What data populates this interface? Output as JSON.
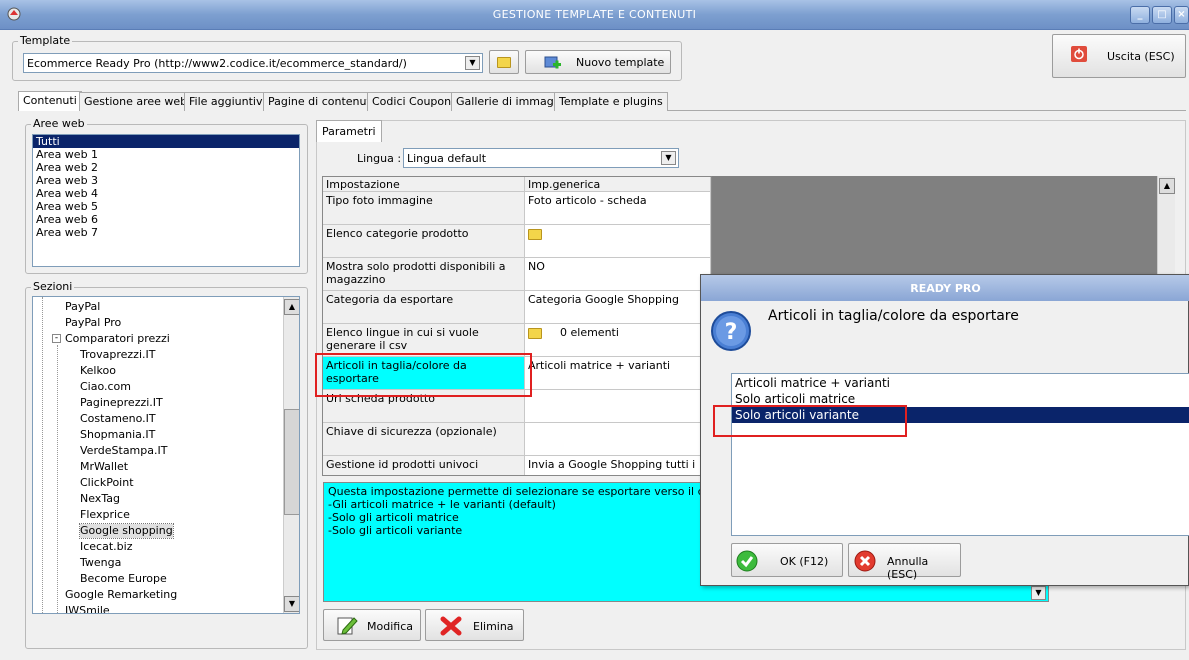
{
  "window": {
    "title": "GESTIONE TEMPLATE E CONTENUTI"
  },
  "template": {
    "group_label": "Template",
    "selected": "Ecommerce Ready Pro (http://www2.codice.it/ecommerce_standard/)",
    "new_button": "Nuovo template"
  },
  "exit_button": "Uscita (ESC)",
  "tabs": [
    "Contenuti",
    "Gestione aree web",
    "File aggiuntivi",
    "Pagine di contenuti",
    "Codici Coupon",
    "Gallerie di immagini",
    "Template e plugins"
  ],
  "aree_web": {
    "label": "Aree web",
    "items": [
      "Tutti",
      "Area web 1",
      "Area web 2",
      "Area web 3",
      "Area web 4",
      "Area web 5",
      "Area web 6",
      "Area web 7"
    ]
  },
  "sezioni": {
    "label": "Sezioni",
    "items": [
      "PayPal",
      "PayPal Pro",
      "Comparatori prezzi",
      "Trovaprezzi.IT",
      "Kelkoo",
      "Ciao.com",
      "Pagineprezzi.IT",
      "Costameno.IT",
      "Shopmania.IT",
      "VerdeStampa.IT",
      "MrWallet",
      "ClickPoint",
      "NexTag",
      "Flexprice",
      "Google shopping",
      "Icecat.biz",
      "Twenga",
      "Become Europe",
      "Google Remarketing",
      "IWSmile"
    ]
  },
  "parametri": {
    "tab": "Parametri",
    "lingua_label": "Lingua :",
    "lingua_value": "Lingua default",
    "headers": [
      "Impostazione",
      "Imp.generica"
    ],
    "rows": [
      {
        "name": "Tipo foto immagine",
        "value": "Foto articolo - scheda"
      },
      {
        "name": "Elenco categorie prodotto",
        "value": ""
      },
      {
        "name": "Mostra solo prodotti disponibili a magazzino",
        "value": "NO"
      },
      {
        "name": "Categoria da esportare",
        "value": "Categoria Google Shopping"
      },
      {
        "name": "Elenco lingue in cui si vuole generare il csv",
        "value": "0 elementi"
      },
      {
        "name": "Articoli in taglia/colore da esportare",
        "value": "Articoli matrice + varianti"
      },
      {
        "name": "Url scheda prodotto",
        "value": ""
      },
      {
        "name": "Chiave di sicurezza (opzionale)",
        "value": ""
      },
      {
        "name": "Gestione id prodotti univoci",
        "value": "Invia a Google Shopping tutti i"
      }
    ],
    "description": [
      "Questa impostazione permette di selezionare se esportare verso il comparatore",
      "-Gli articoli matrice + le varianti (default)",
      "-Solo gli articoli matrice",
      "-Solo gli articoli variante"
    ],
    "modify_button": "Modifica",
    "delete_button": "Elimina"
  },
  "dialog": {
    "title": "READY PRO",
    "question": "Articoli in taglia/colore da esportare",
    "options": [
      "Articoli matrice + varianti",
      "Solo articoli matrice",
      "Solo articoli variante"
    ],
    "selected_index": 2,
    "ok_button": "OK (F12)",
    "cancel_button": "Annulla (ESC)"
  }
}
